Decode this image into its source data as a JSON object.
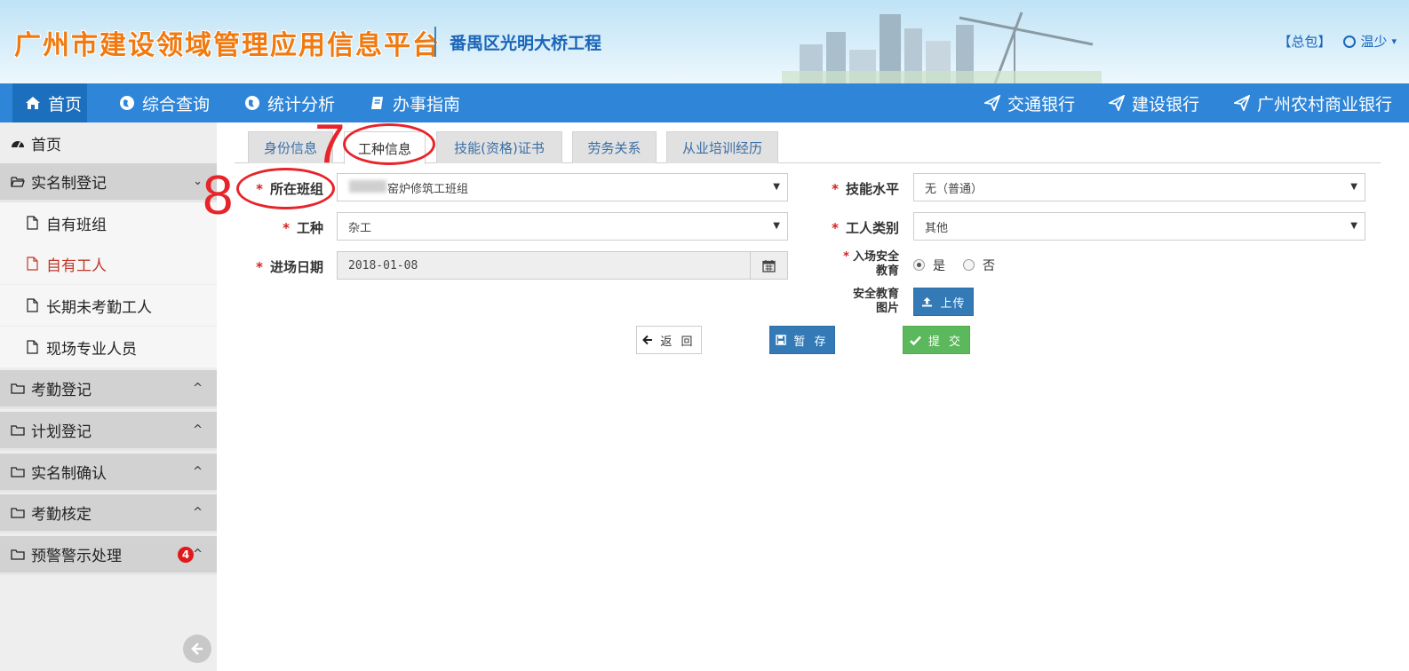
{
  "header": {
    "site_title": "广州市建设领域管理应用信息平台",
    "project_name": "番禺区光明大桥工程",
    "role_label": "【总包】",
    "user_name": "温少"
  },
  "nav": {
    "items": [
      {
        "label": "首页",
        "icon": "home-icon"
      },
      {
        "label": "综合查询",
        "icon": "globe-icon"
      },
      {
        "label": "统计分析",
        "icon": "globe-icon"
      },
      {
        "label": "办事指南",
        "icon": "book-icon"
      }
    ],
    "banks": [
      {
        "label": "交通银行",
        "icon": "send-icon"
      },
      {
        "label": "建设银行",
        "icon": "send-icon"
      },
      {
        "label": "广州农村商业银行",
        "icon": "send-icon"
      }
    ]
  },
  "sidebar": {
    "home": "首页",
    "groups": [
      {
        "label": "实名制登记",
        "expanded": true
      },
      {
        "label": "考勤登记"
      },
      {
        "label": "计划登记"
      },
      {
        "label": "实名制确认"
      },
      {
        "label": "考勤核定"
      },
      {
        "label": "预警警示处理",
        "badge": "4"
      }
    ],
    "subitems": [
      {
        "label": "自有班组"
      },
      {
        "label": "自有工人",
        "active": true
      },
      {
        "label": "长期未考勤工人"
      },
      {
        "label": "现场专业人员"
      }
    ]
  },
  "tabs": [
    {
      "label": "身份信息"
    },
    {
      "label": "工种信息",
      "active": true
    },
    {
      "label": "技能(资格)证书"
    },
    {
      "label": "劳务关系"
    },
    {
      "label": "从业培训经历"
    }
  ],
  "form": {
    "team_label": "所在班组",
    "team_value": "窑炉修筑工班组",
    "skill_label": "技能水平",
    "skill_value": "无（普通）",
    "trade_label": "工种",
    "trade_value": "杂工",
    "worker_type_label": "工人类别",
    "worker_type_value": "其他",
    "entry_date_label": "进场日期",
    "entry_date_value": "2018-01-08",
    "safety_edu_label_1": "入场安全",
    "safety_edu_label_2": "教育",
    "radio_yes": "是",
    "radio_no": "否",
    "safety_photo_label_1": "安全教育",
    "safety_photo_label_2": "图片",
    "upload_label": "上传",
    "required_mark": "*"
  },
  "actions": {
    "back": "返 回",
    "save": "暂 存",
    "submit": "提 交"
  },
  "annotations": {
    "step_7": "7",
    "step_8": "8"
  },
  "colors": {
    "nav_bg": "#2f86d9",
    "title_orange": "#f07a10",
    "annotation_red": "#e8242b",
    "primary_btn": "#337ab7",
    "success_btn": "#5cb85c"
  }
}
